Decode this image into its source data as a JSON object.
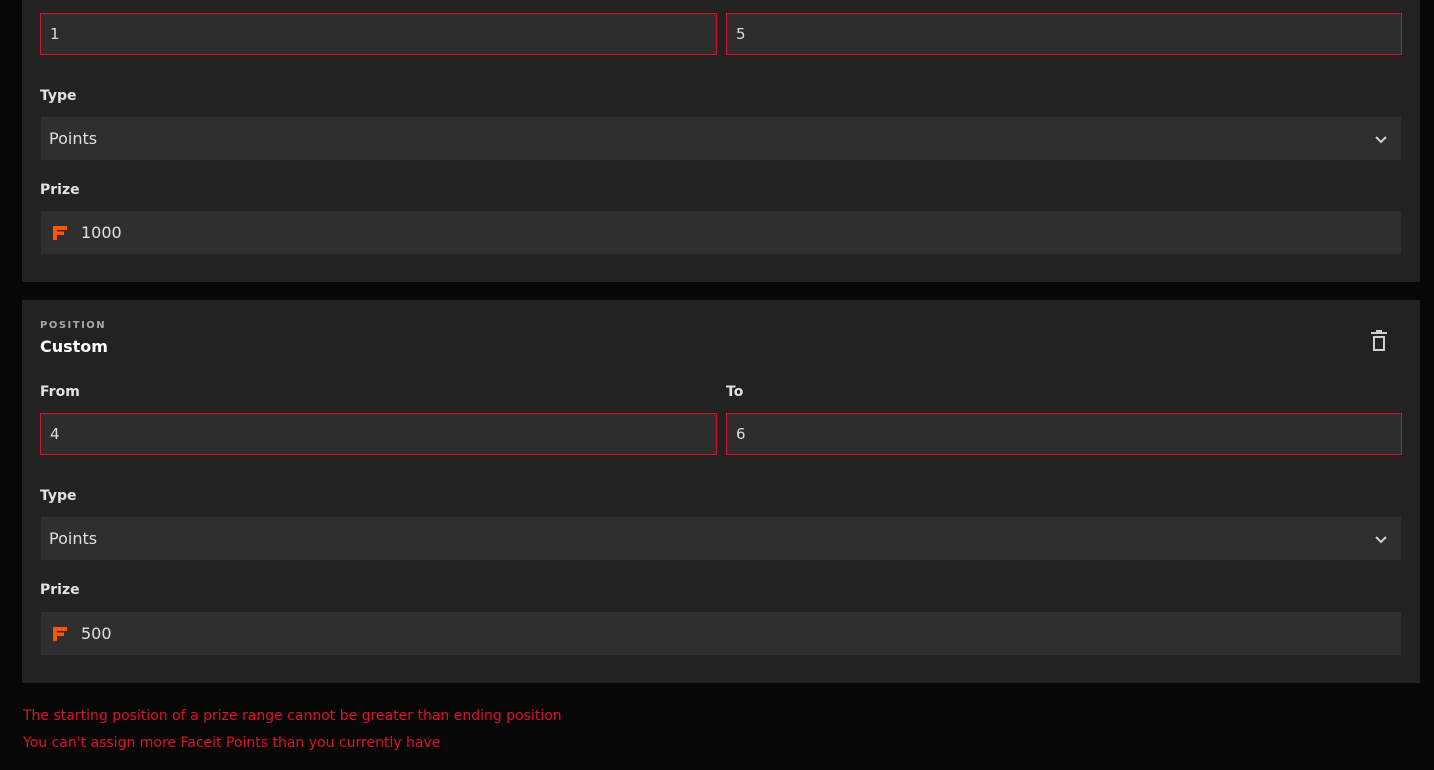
{
  "tier1": {
    "from_value": "1",
    "to_value": "5",
    "type_label": "Type",
    "type_value": "Points",
    "prize_label": "Prize",
    "prize_value": "1000"
  },
  "tier2": {
    "overline": "POSITION",
    "title": "Custom",
    "from_label": "From",
    "to_label": "To",
    "from_value": "4",
    "to_value": "6",
    "type_label": "Type",
    "type_value": "Points",
    "prize_label": "Prize",
    "prize_value": "500"
  },
  "errors": [
    "The starting position of a prize range cannot be greater than ending position",
    "You can't assign more Faceit Points than you currently have"
  ],
  "colors": {
    "accent": "#ff5500",
    "error": "#e0112b",
    "card": "#222222",
    "field": "#2f2f2f"
  },
  "icons": {
    "currency": "faceit-points-icon",
    "select": "chevron-down-icon",
    "delete": "trash-icon"
  }
}
